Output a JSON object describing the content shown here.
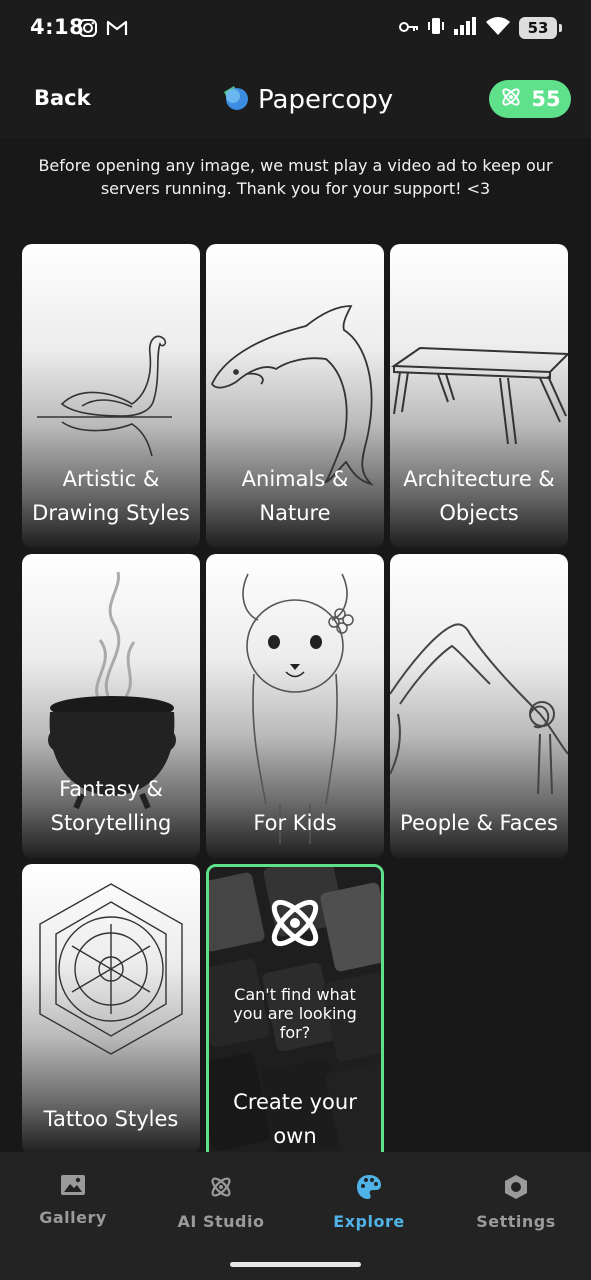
{
  "status": {
    "time": "4:18",
    "battery": "53",
    "icons": [
      "instagram-icon",
      "gmail-icon",
      "key-icon",
      "vibrate-icon",
      "signal-icon",
      "wifi-icon",
      "battery-icon"
    ]
  },
  "header": {
    "back_label": "Back",
    "app_name": "Papercopy",
    "credits": "55",
    "accent": "#5fe08a"
  },
  "notice": "Before opening any image, we must play a video ad to keep our servers running. Thank you for your support! <3",
  "categories": [
    {
      "label": "Artistic & Drawing Styles",
      "icon": "swan-illustration"
    },
    {
      "label": "Animals & Nature",
      "icon": "dolphin-illustration"
    },
    {
      "label": "Architecture & Objects",
      "icon": "table-illustration"
    },
    {
      "label": "Fantasy & Storytelling",
      "icon": "cauldron-illustration"
    },
    {
      "label": "For Kids",
      "icon": "llama-illustration"
    },
    {
      "label": "People & Faces",
      "icon": "yoga-person-illustration"
    },
    {
      "label": "Tattoo Styles",
      "icon": "mandala-illustration"
    }
  ],
  "create_card": {
    "question": "Can't find what you are looking for?",
    "cta": "Create your own"
  },
  "nav": {
    "items": [
      {
        "label": "Gallery",
        "icon": "image-icon"
      },
      {
        "label": "AI Studio",
        "icon": "atom-icon"
      },
      {
        "label": "Explore",
        "icon": "palette-icon",
        "active": true
      },
      {
        "label": "Settings",
        "icon": "hexagon-gear-icon"
      }
    ],
    "active_color": "#4fb3e8"
  }
}
